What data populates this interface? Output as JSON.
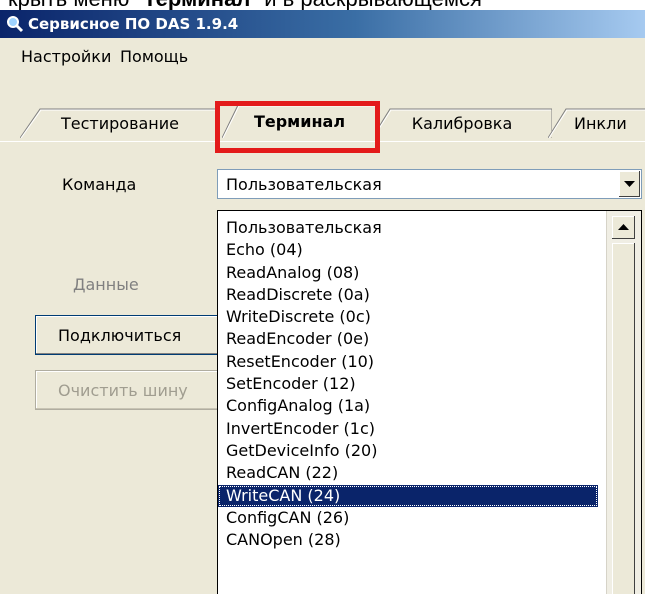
{
  "caption": {
    "prefix": "крыть меню \"",
    "bold": "Терминал",
    "suffix": "\" и в раскрывающемся"
  },
  "window": {
    "title": "Сервисное ПО DAS 1.9.4",
    "icon": "magnifier-icon"
  },
  "menu": {
    "items": [
      "Настройки",
      "Помощь"
    ]
  },
  "tabs": [
    {
      "label": "Тестирование",
      "active": false
    },
    {
      "label": "Терминал",
      "active": true
    },
    {
      "label": "Калибровка",
      "active": false
    },
    {
      "label": "Инкли",
      "active": false
    }
  ],
  "form": {
    "command_label": "Команда",
    "data_label": "Данные",
    "command_value": "Пользовательская",
    "connect_label": "Подключиться",
    "clear_bus_label": "Очистить шину"
  },
  "dropdown": {
    "selected_index": 12,
    "options": [
      "Пользовательская",
      "Echo (04)",
      "ReadAnalog (08)",
      "ReadDiscrete (0a)",
      "WriteDiscrete (0c)",
      "ReadEncoder (0e)",
      "ResetEncoder (10)",
      "SetEncoder (12)",
      "ConfigAnalog (1a)",
      "InvertEncoder (1c)",
      "GetDeviceInfo (20)",
      "ReadCAN (22)",
      "WriteCAN (24)",
      "ConfigCAN (26)",
      "CANOpen (28)"
    ]
  },
  "colors": {
    "highlight": "#e31b1b",
    "selection": "#0a246a",
    "title_bar": "#0a246a"
  }
}
